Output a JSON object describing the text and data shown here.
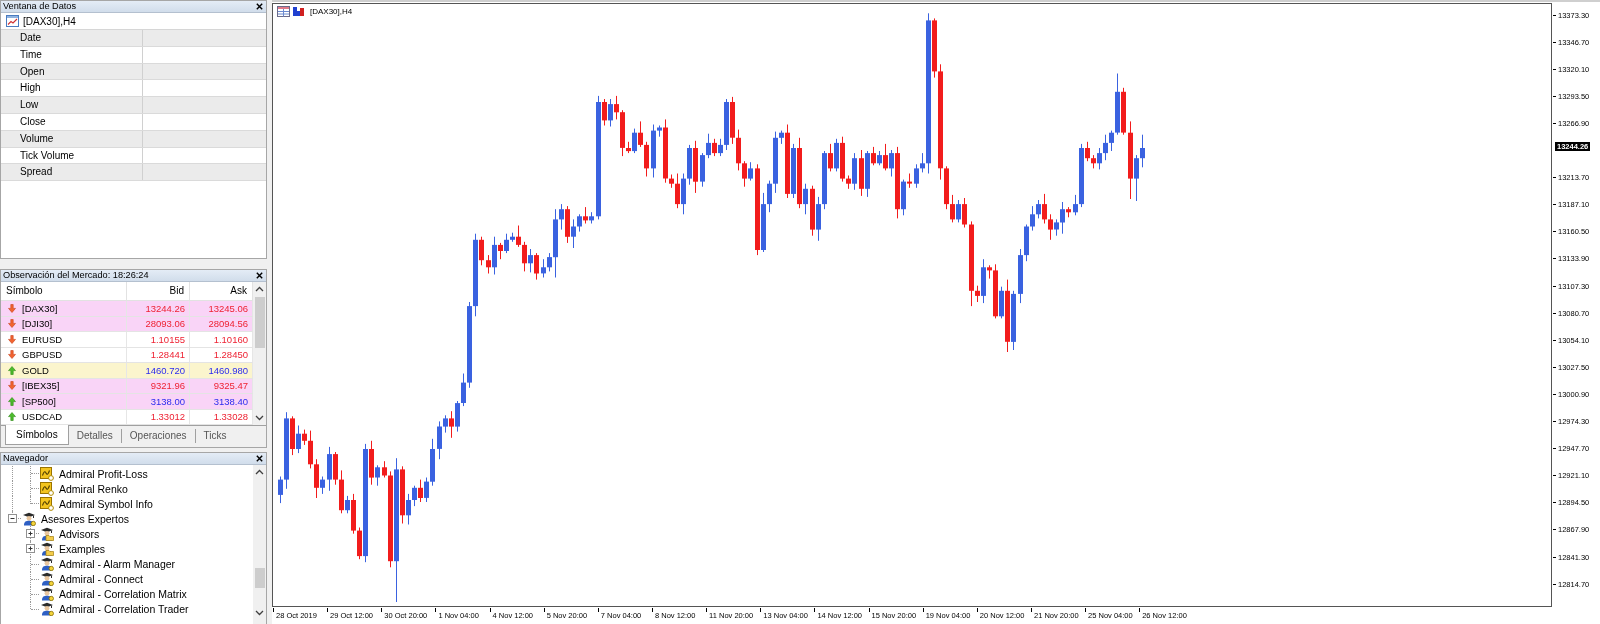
{
  "data_window": {
    "title": "Ventana de Datos",
    "symbol": "[DAX30],H4",
    "fields": [
      "Date",
      "Time",
      "Open",
      "High",
      "Low",
      "Close",
      "Volume",
      "Tick Volume",
      "Spread"
    ]
  },
  "market_watch": {
    "title": "Observación del Mercado: 18:26:24",
    "columns": [
      "Símbolo",
      "Bid",
      "Ask"
    ],
    "rows": [
      {
        "symbol": "[DAX30]",
        "bid": "13244.26",
        "ask": "13245.06",
        "rising": false,
        "price_up": false,
        "kind": "index"
      },
      {
        "symbol": "[DJI30]",
        "bid": "28093.06",
        "ask": "28094.56",
        "rising": false,
        "price_up": false,
        "kind": "index"
      },
      {
        "symbol": "EURUSD",
        "bid": "1.10155",
        "ask": "1.10160",
        "rising": false,
        "price_up": false,
        "kind": "currency"
      },
      {
        "symbol": "GBPUSD",
        "bid": "1.28441",
        "ask": "1.28450",
        "rising": false,
        "price_up": false,
        "kind": "currency"
      },
      {
        "symbol": "GOLD",
        "bid": "1460.720",
        "ask": "1460.980",
        "rising": true,
        "price_up": true,
        "kind": "metal"
      },
      {
        "symbol": "[IBEX35]",
        "bid": "9321.96",
        "ask": "9325.47",
        "rising": false,
        "price_up": false,
        "kind": "index"
      },
      {
        "symbol": "[SP500]",
        "bid": "3138.00",
        "ask": "3138.40",
        "rising": true,
        "price_up": true,
        "kind": "index"
      },
      {
        "symbol": "USDCAD",
        "bid": "1.33012",
        "ask": "1.33028",
        "rising": true,
        "price_up": false,
        "kind": "currency"
      }
    ],
    "tabs": [
      {
        "label": "Símbolos",
        "selected": true
      },
      {
        "label": "Detalles",
        "selected": false
      },
      {
        "label": "Operaciones",
        "selected": false
      },
      {
        "label": "Ticks",
        "selected": false
      }
    ]
  },
  "navigator": {
    "title": "Navegador",
    "tree": [
      {
        "children": [
          {
            "label": "Admiral Profit-Loss",
            "kind": "indicator"
          },
          {
            "label": "Admiral Renko",
            "kind": "indicator"
          },
          {
            "label": "Admiral Symbol Info",
            "kind": "indicator"
          }
        ]
      },
      {
        "label": "Asesores Expertos",
        "kind": "expert",
        "expanded": true,
        "children": [
          {
            "label": "Advisors",
            "kind": "folder",
            "expanded": false
          },
          {
            "label": "Examples",
            "kind": "folder",
            "expanded": false
          },
          {
            "label": "Admiral - Alarm Manager",
            "kind": "expert"
          },
          {
            "label": "Admiral - Connect",
            "kind": "expert"
          },
          {
            "label": "Admiral - Correlation Matrix",
            "kind": "expert"
          },
          {
            "label": "Admiral - Correlation Trader",
            "kind": "expert"
          }
        ]
      }
    ]
  },
  "chart": {
    "title": "[DAX30],H4",
    "price_labels": [
      "13373.30",
      "13346.70",
      "13320.10",
      "13293.50",
      "13266.90",
      "13213.70",
      "13187.10",
      "13160.50",
      "13133.90",
      "13107.30",
      "13080.70",
      "13054.10",
      "13027.50",
      "13000.90",
      "12974.30",
      "12947.70",
      "12921.10",
      "12894.50",
      "12867.90",
      "12841.30",
      "12814.70"
    ],
    "current_price": "13244.26",
    "time_labels": [
      "28 Oct 2019",
      "29 Oct 12:00",
      "30 Oct 20:00",
      "1 Nov 04:00",
      "4 Nov 12:00",
      "5 Nov 20:00",
      "7 Nov 04:00",
      "8 Nov 12:00",
      "11 Nov 20:00",
      "13 Nov 04:00",
      "14 Nov 12:00",
      "15 Nov 20:00",
      "19 Nov 04:00",
      "20 Nov 12:00",
      "21 Nov 20:00",
      "25 Nov 04:00",
      "26 Nov 12:00"
    ]
  }
}
